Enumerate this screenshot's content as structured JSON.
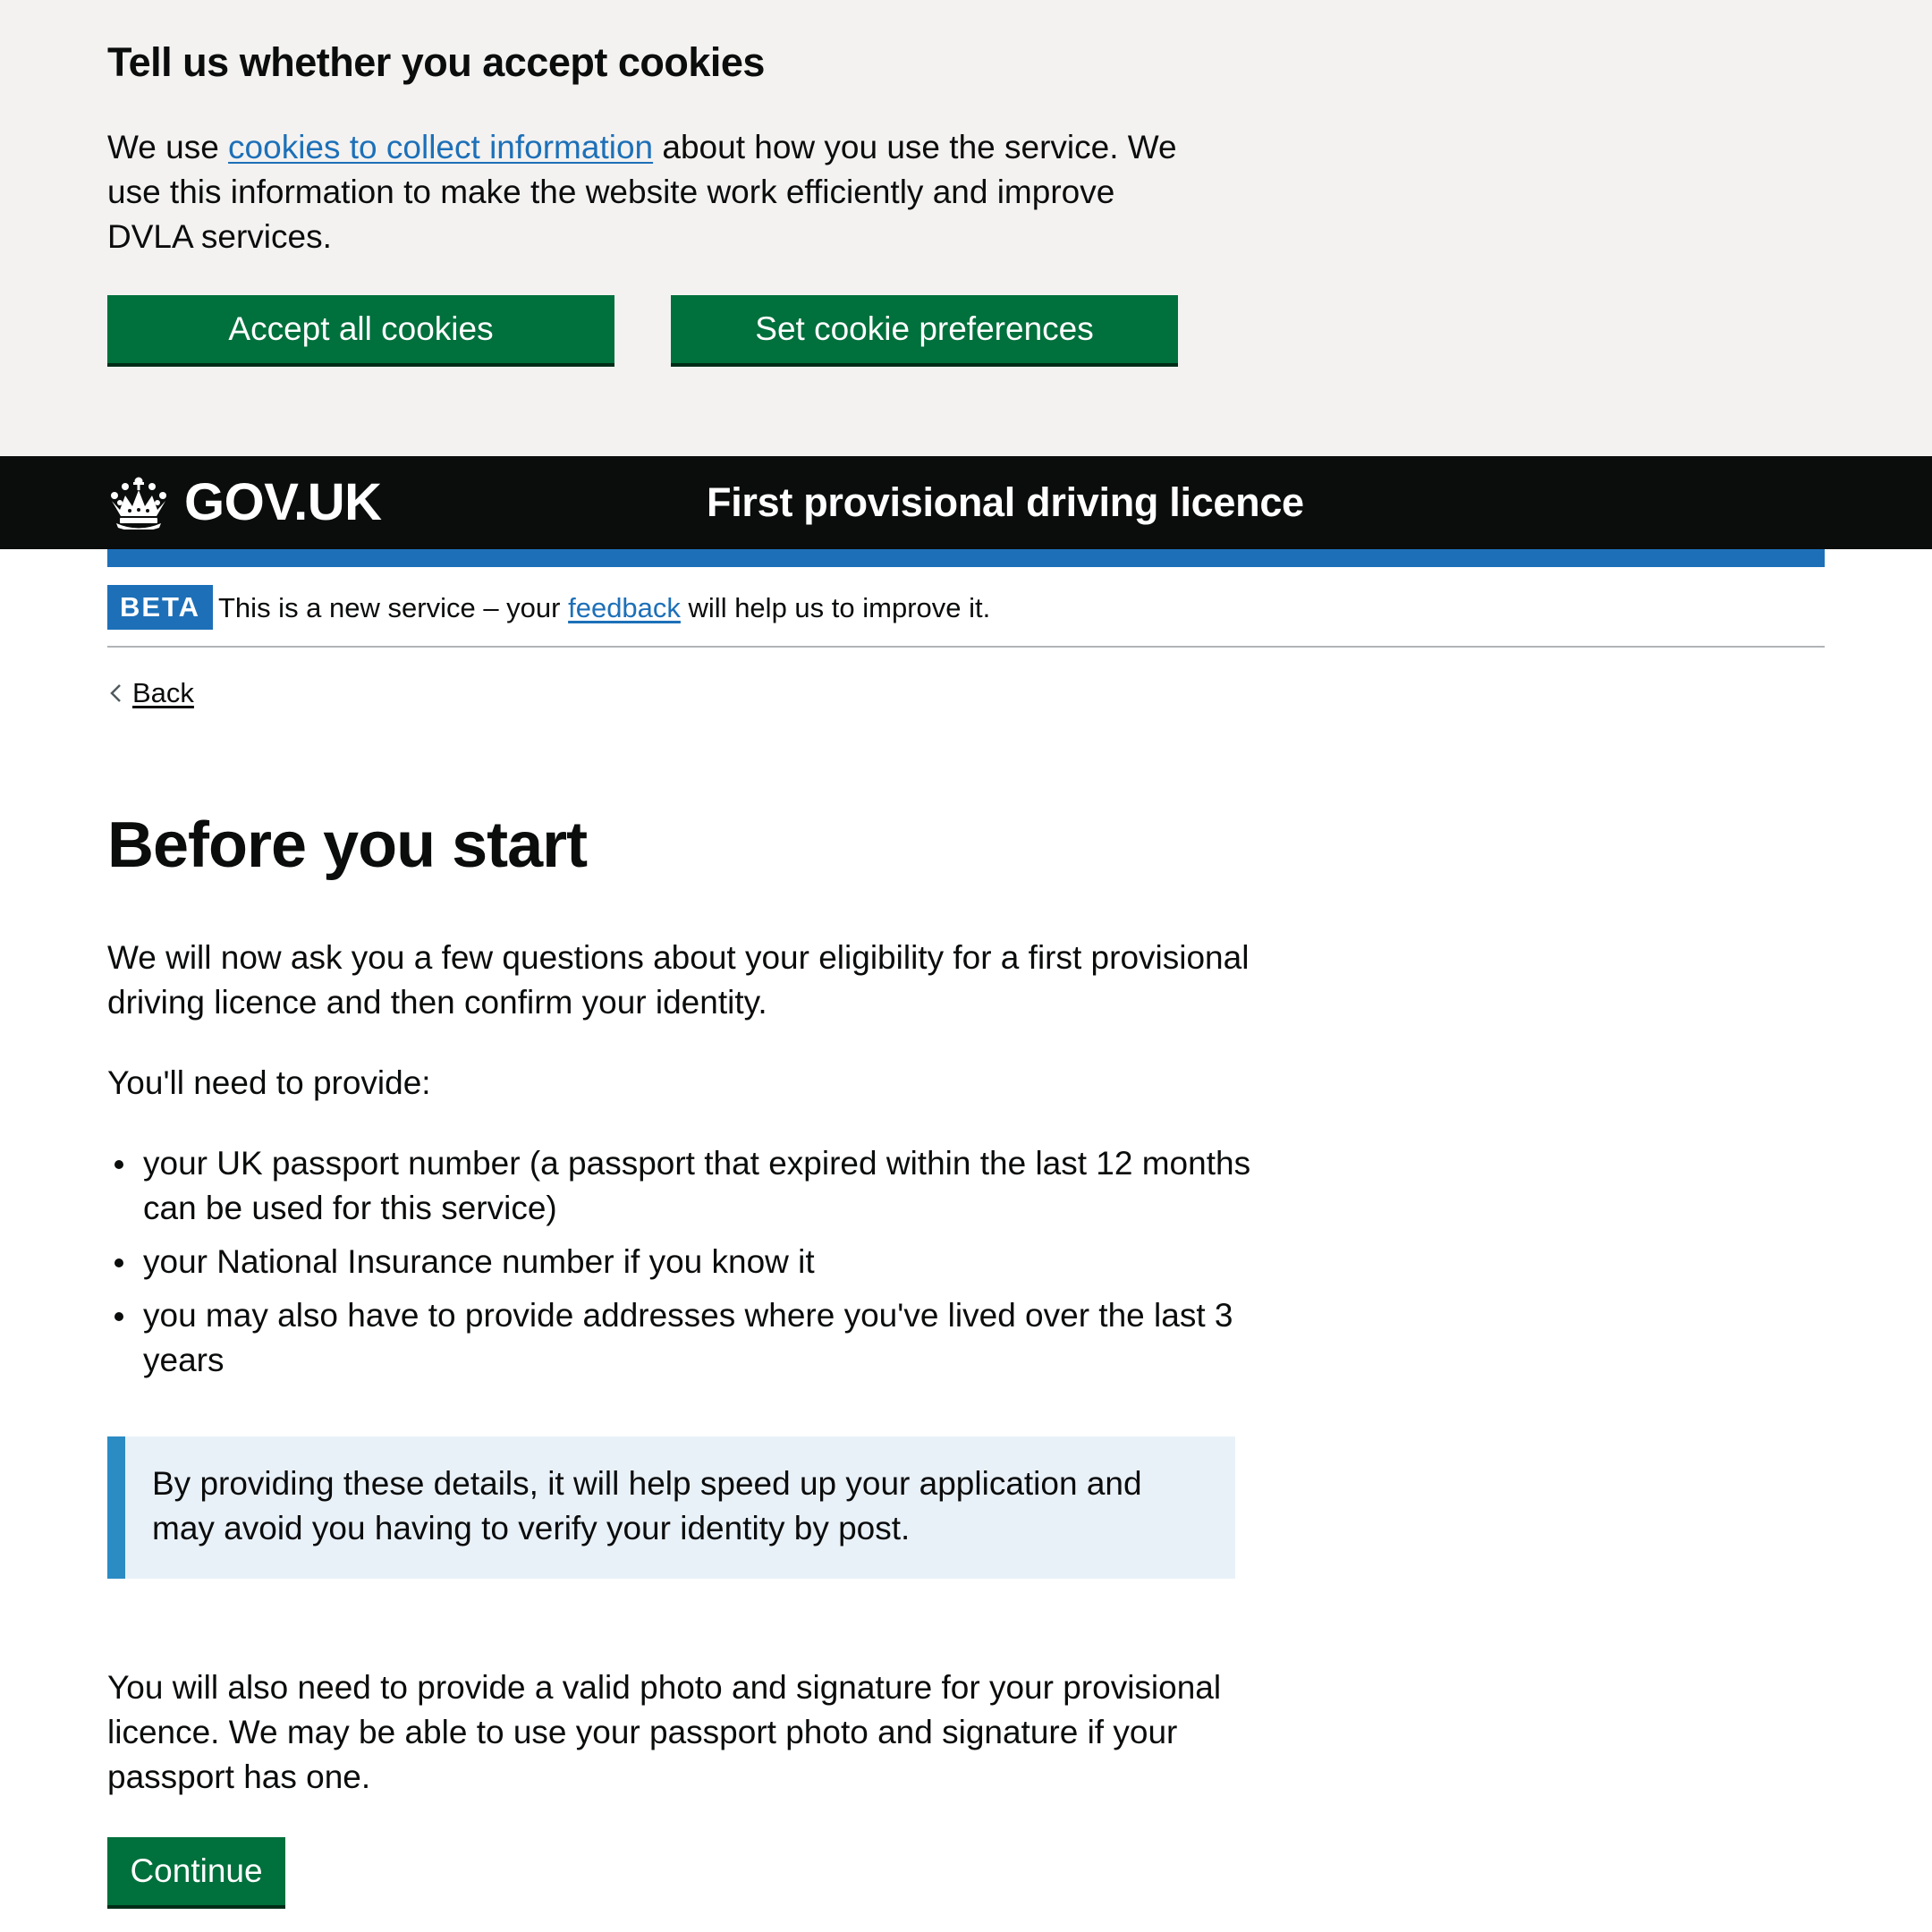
{
  "cookie_banner": {
    "title": "Tell us whether you accept cookies",
    "text_before_link": "We use ",
    "link_text": "cookies to collect information",
    "text_after_link": " about how you use the service. We use this information to make the website work efficiently and improve DVLA services.",
    "accept_label": "Accept all cookies",
    "preferences_label": "Set cookie preferences"
  },
  "header": {
    "logo_text": "GOV.UK",
    "logo_icon": "crown-icon",
    "service_name": "First provisional driving licence"
  },
  "phase_banner": {
    "tag": "BETA",
    "text_before_link": "This is a new service – your ",
    "link_text": "feedback",
    "text_after_link": " will help us to improve it."
  },
  "back_link": {
    "label": "Back",
    "icon": "chevron-left-icon"
  },
  "main": {
    "title": "Before you start",
    "intro": "We will now ask you a few questions about your eligibility for a first provisional driving licence and then confirm your identity.",
    "need_heading": "You'll need to provide:",
    "requirements": [
      "your UK passport number (a passport that expired within the last 12 months can be used for this service)",
      "your National Insurance number if you know it",
      "you may also have to provide addresses where you've lived over the last 3 years"
    ],
    "inset_text": "By providing these details, it will help speed up your application and may avoid you having to verify your identity by post.",
    "photo_text": "You will also need to provide a valid photo and signature for your provisional licence. We may be able to use your passport photo and signature if your passport has one.",
    "continue_label": "Continue"
  },
  "colors": {
    "button_green": "#00703c",
    "link_blue": "#1d70b8",
    "header_black": "#0b0c0c",
    "banner_grey": "#f3f2f1",
    "inset_border": "#2b8cc4",
    "inset_background": "#e9f1f8"
  }
}
